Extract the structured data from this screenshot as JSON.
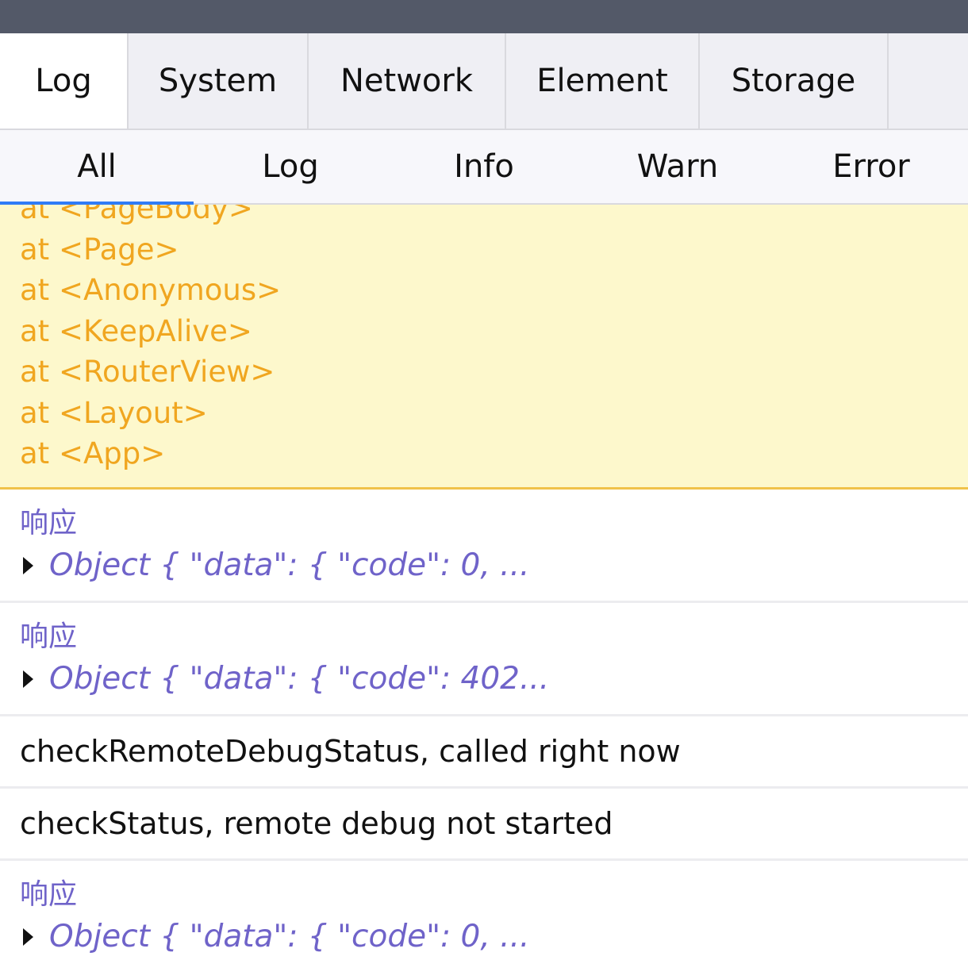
{
  "tabs": [
    {
      "label": "Log"
    },
    {
      "label": "System"
    },
    {
      "label": "Network"
    },
    {
      "label": "Element"
    },
    {
      "label": "Storage"
    }
  ],
  "subtabs": [
    {
      "label": "All"
    },
    {
      "label": "Log"
    },
    {
      "label": "Info"
    },
    {
      "label": "Warn"
    },
    {
      "label": "Error"
    }
  ],
  "warn": {
    "lines": [
      "at <PageBody>",
      "at <Page>",
      "at <Anonymous>",
      "at <KeepAlive>",
      "at <RouterView>",
      "at <Layout>",
      "at <App>"
    ]
  },
  "entries": [
    {
      "label": "响应",
      "object": "Object { \"data\": { \"code\": 0, ..."
    },
    {
      "label": "响应",
      "object": "Object { \"data\": { \"code\": 402..."
    },
    {
      "text": "checkRemoteDebugStatus, called right now"
    },
    {
      "text": "checkStatus, remote debug not started"
    },
    {
      "label": "响应",
      "object": "Object { \"data\": { \"code\": 0, ..."
    }
  ]
}
